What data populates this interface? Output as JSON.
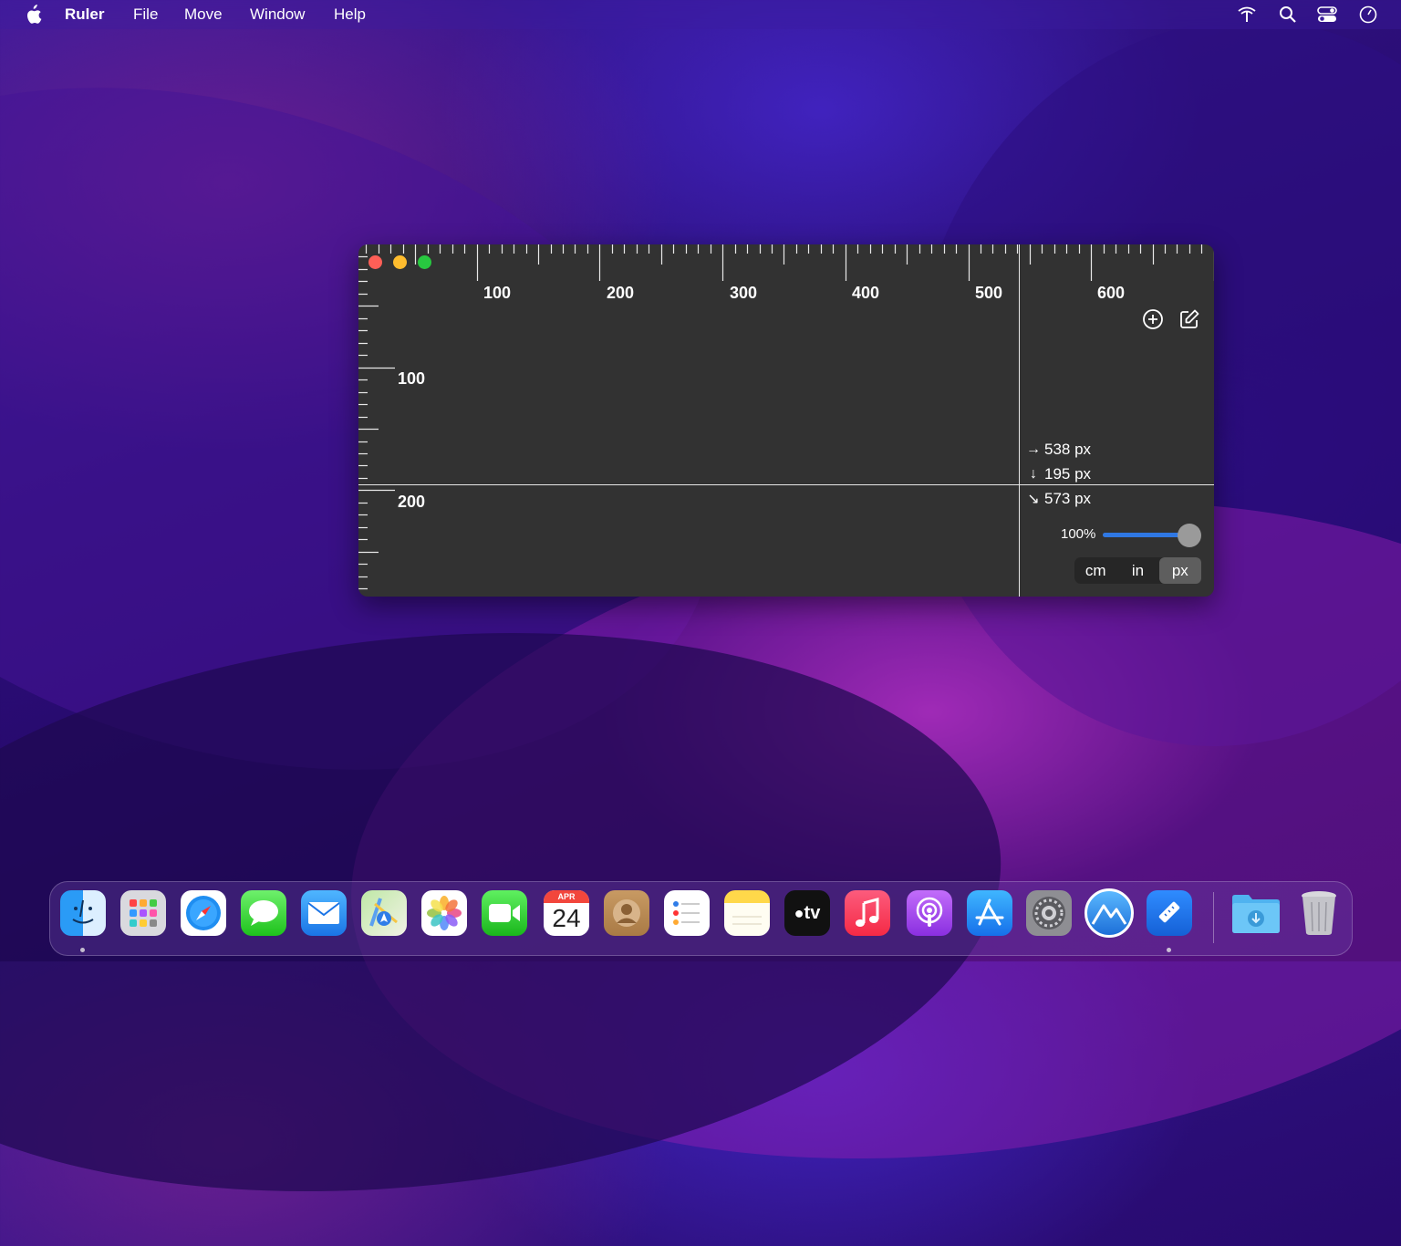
{
  "menubar": {
    "app_name": "Ruler",
    "menus": [
      "File",
      "Move",
      "Window",
      "Help"
    ],
    "status_icons": [
      "network-icon",
      "search-icon",
      "control-center-icon",
      "clock-icon"
    ]
  },
  "ruler": {
    "horizontal_labels": [
      "100",
      "200",
      "300",
      "400",
      "500",
      "600"
    ],
    "vertical_labels": [
      "100",
      "200"
    ],
    "readouts": [
      {
        "arrow": "→",
        "text": "538 px"
      },
      {
        "arrow": "↓",
        "text": "195 px"
      },
      {
        "arrow": "↘",
        "text": "573 px"
      }
    ],
    "zoom": {
      "label": "100%",
      "value": 1.0
    },
    "units": [
      "cm",
      "in",
      "px"
    ],
    "selected_unit": "px",
    "colors": {
      "background": "#323232",
      "accent": "#2f78e4"
    }
  },
  "calendar": {
    "month": "APR",
    "day": "24"
  },
  "dock": {
    "apps": [
      "Finder",
      "Launchpad",
      "Safari",
      "Messages",
      "Mail",
      "Maps",
      "Photos",
      "FaceTime",
      "Calendar",
      "Contacts",
      "Reminders",
      "Notes",
      "TV",
      "Music",
      "Podcasts",
      "App Store",
      "System Preferences",
      "Sketch",
      "Ruler",
      "Downloads",
      "Trash"
    ],
    "tv_label": "tv"
  }
}
